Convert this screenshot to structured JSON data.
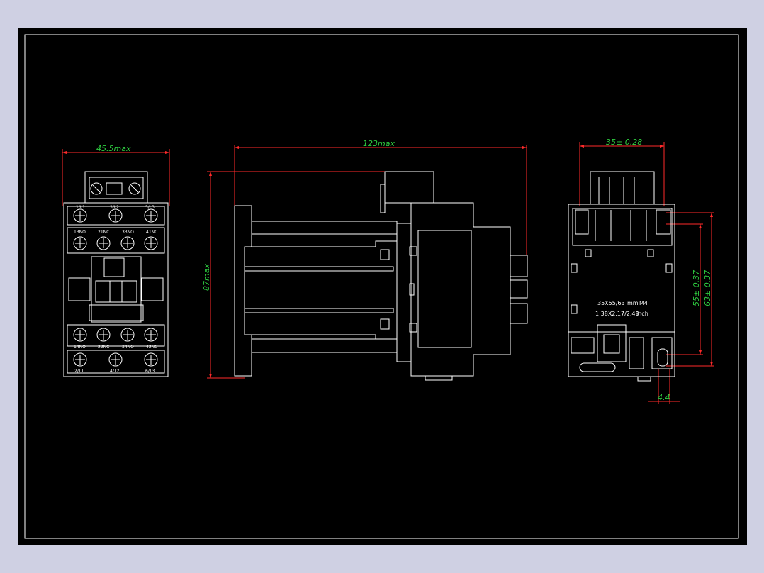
{
  "drawing": {
    "dimensions": {
      "front_width": "45.5max",
      "side_length": "123max",
      "side_height": "87max",
      "right_width": "35± 0.28",
      "right_h1": "55± 0.37",
      "right_h2": "63± 0.37",
      "right_bottom": "4.4"
    },
    "front_labels": {
      "top_row": [
        "1/L1",
        "3/L2",
        "5/L3"
      ],
      "aux_top": [
        "13NO",
        "21NC",
        "33NO",
        "41NC"
      ],
      "aux_bottom": [
        "14NO",
        "22NC",
        "34NO",
        "42NC"
      ],
      "bottom_row": [
        "2/T1",
        "4/T2",
        "6/T3"
      ]
    },
    "mounting_text": {
      "line1": "35X55/63",
      "unit1": "mm",
      "screw": "M4",
      "line2": "1.38X2.17/2.48",
      "unit2": "inch"
    },
    "colors": {
      "background": "#cfd0e3",
      "canvas": "#000000",
      "outline": "#ffffff",
      "dimension_line": "#ff2a2a",
      "dimension_text": "#2ecc40"
    }
  }
}
